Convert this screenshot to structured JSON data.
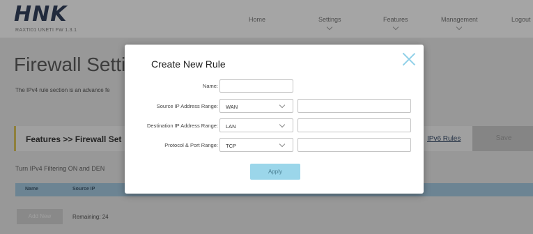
{
  "header": {
    "logo": "HNK",
    "firmware_version": "RAXTI01 UNETI FW 1.3.1",
    "nav": [
      "Home",
      "Settings",
      "Features",
      "Management",
      "Logout"
    ]
  },
  "page": {
    "title": "Firewall Settin",
    "description": "The IPv4 rule section is an advance fe",
    "breadcrumb": "Features >> Firewall Set",
    "ipv6_link": "IPv6 Rules",
    "save_label": "Save",
    "filter_text": "Turn IPv4 Filtering ON and DEN",
    "table_columns": [
      "Name",
      "Source IP"
    ],
    "add_button": "Add New",
    "remaining": "Remaining: 24"
  },
  "modal": {
    "title": "Create New Rule",
    "fields": {
      "name": {
        "label": "Name:",
        "value": ""
      },
      "source": {
        "label": "Source IP Address Range:",
        "select": "WAN",
        "value": ""
      },
      "destination": {
        "label": "Destination IP Address Range:",
        "select": "LAN",
        "value": ""
      },
      "protocol": {
        "label": "Protocol & Port Range:",
        "select": "TCP",
        "value": ""
      }
    },
    "apply_label": "Apply"
  },
  "colors": {
    "accent": "#9bd6ea",
    "close_icon": "#8fd0e8",
    "table_header": "#9ec7e0",
    "breadcrumb_accent": "#d9c04a"
  }
}
